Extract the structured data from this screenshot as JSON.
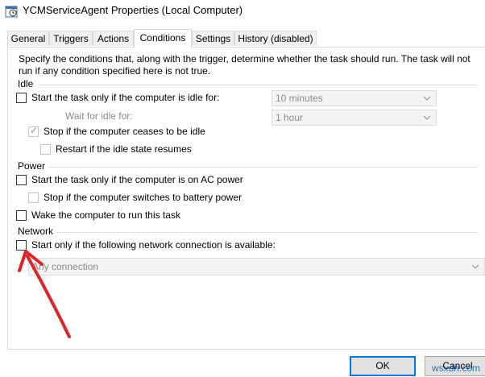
{
  "window": {
    "title": "YCMServiceAgent Properties (Local Computer)",
    "icon": "scheduled-task-icon"
  },
  "tabs": [
    {
      "label": "General"
    },
    {
      "label": "Triggers"
    },
    {
      "label": "Actions"
    },
    {
      "label": "Conditions",
      "active": true
    },
    {
      "label": "Settings"
    },
    {
      "label": "History (disabled)"
    }
  ],
  "conditions": {
    "description": "Specify the conditions that, along with the trigger, determine whether the task should run.  The task will not run  if any condition specified here is not true.",
    "idle": {
      "title": "Idle",
      "start_idle_label": "Start the task only if the computer is idle for:",
      "start_idle_checked": false,
      "idle_duration": "10 minutes",
      "wait_for_idle_label": "Wait for idle for:",
      "wait_duration": "1 hour",
      "stop_idle_label": "Stop if the computer ceases to be idle",
      "stop_idle_checked": true,
      "restart_idle_label": "Restart if the idle state resumes",
      "restart_idle_checked": false
    },
    "power": {
      "title": "Power",
      "ac_power_label": "Start the task only if the computer is on AC power",
      "ac_power_checked": false,
      "battery_label": "Stop if the computer switches to battery power",
      "battery_checked": false,
      "wake_label": "Wake the computer to run this task",
      "wake_checked": false
    },
    "network": {
      "title": "Network",
      "network_label": "Start only if the following network connection is available:",
      "network_checked": false,
      "connection": "Any connection"
    }
  },
  "buttons": {
    "ok": "OK",
    "cancel": "Cancel"
  },
  "annotation": {
    "arrow_color": "#d9262a"
  },
  "watermark": "wsxdn.com"
}
